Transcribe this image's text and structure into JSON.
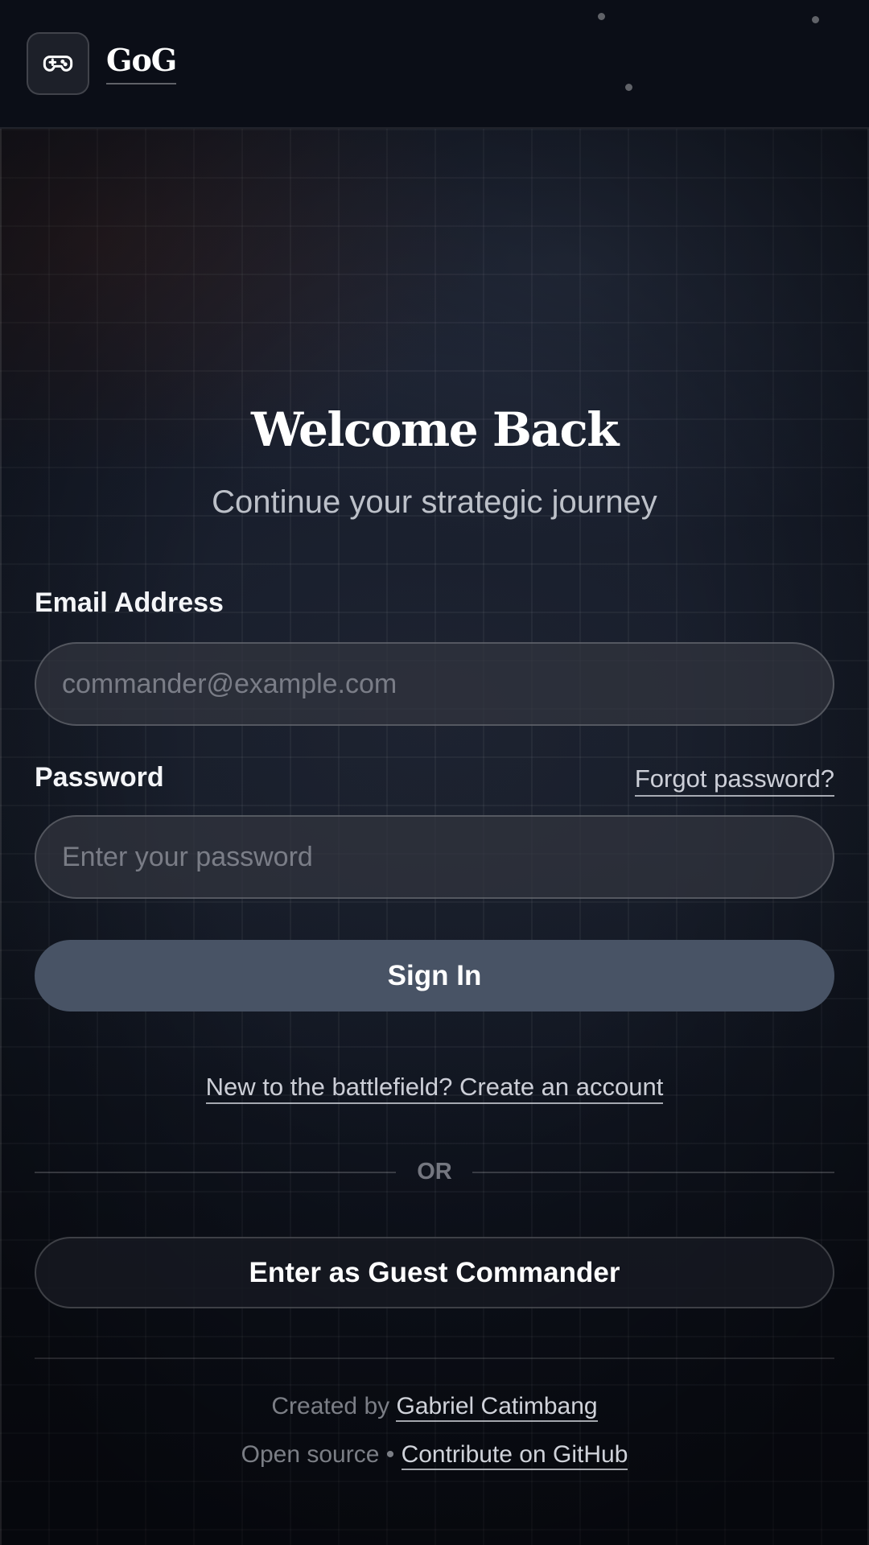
{
  "header": {
    "brand": "GoG",
    "logo_icon": "gamepad-icon"
  },
  "main": {
    "title": "Welcome Back",
    "subtitle": "Continue your strategic journey"
  },
  "form": {
    "email_label": "Email Address",
    "email_placeholder": "commander@example.com",
    "email_value": "",
    "password_label": "Password",
    "password_placeholder": "Enter your password",
    "password_value": "",
    "forgot_link": "Forgot password?",
    "signin_label": "Sign In",
    "create_account_link": "New to the battlefield? Create an account",
    "divider_text": "OR",
    "guest_label": "Enter as Guest Commander"
  },
  "footer": {
    "created_prefix": "Created by",
    "author_link": "Gabriel Catimbang",
    "opensource_prefix": "Open source •",
    "github_link": "Contribute on GitHub"
  },
  "colors": {
    "background": "#0b0f18",
    "primary_button": "#485365",
    "text": "#ffffff"
  }
}
